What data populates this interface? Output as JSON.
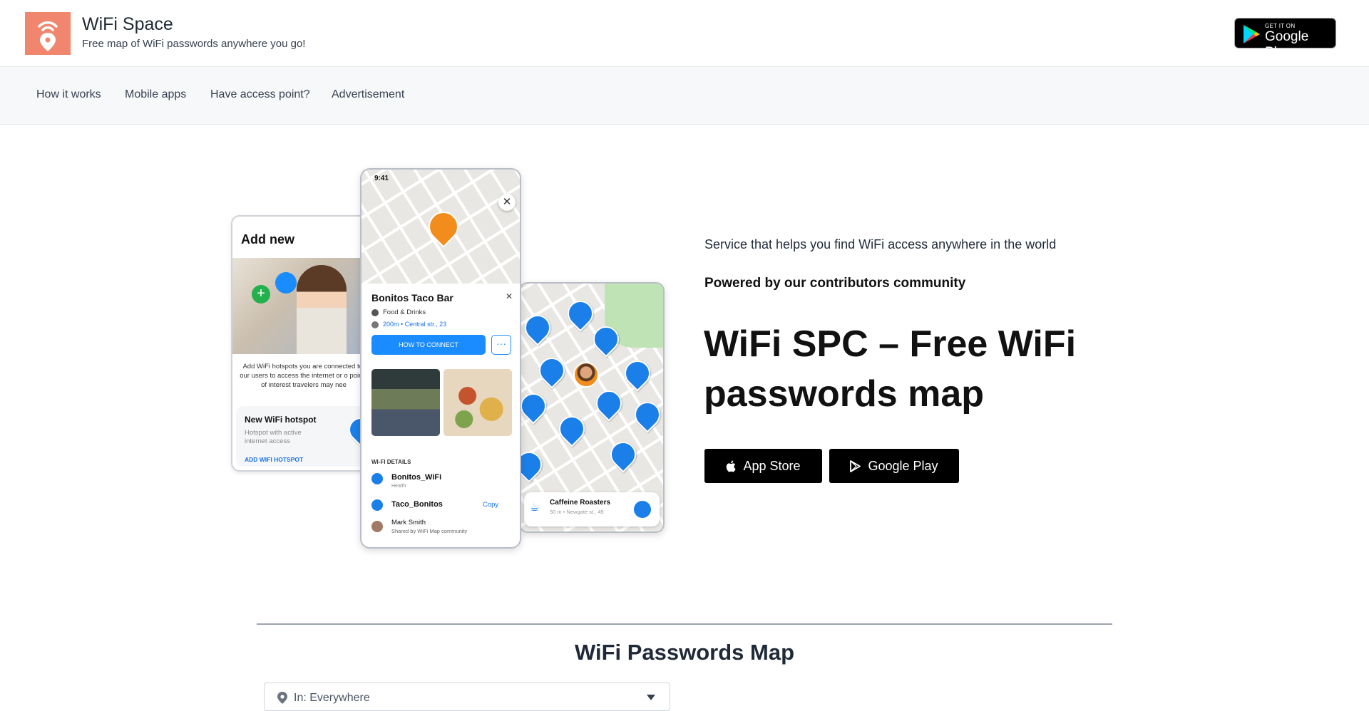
{
  "header": {
    "brand_title": "WiFi Space",
    "brand_tagline": "Free map of WiFi passwords anywhere you go!",
    "badge_small": "GET IT ON",
    "badge_big": "Google Play"
  },
  "nav": {
    "items": [
      {
        "label": "How it works"
      },
      {
        "label": "Mobile apps"
      },
      {
        "label": "Have access point?"
      },
      {
        "label": "Advertisement"
      }
    ]
  },
  "hero": {
    "subtitle": "Service that helps you find WiFi access anywhere in the world",
    "powered": "Powered by our contributors community",
    "title": "WiFi SPC – Free WiFi passwords map",
    "app_store_label": "App Store",
    "google_play_label": "Google Play"
  },
  "mockups": {
    "left": {
      "title": "Add new",
      "description": "Add WiFi hotspots you are connected to, our users to access the internet or o points of interest travelers may nee",
      "hotspot_title": "New WiFi hotspot",
      "hotspot_desc": "Hotspot with active internet access",
      "hotspot_link": "ADD WIFI HOTSPOT"
    },
    "middle": {
      "time": "9:41",
      "place_name": "Bonitos Taco Bar",
      "category": "Food & Drinks",
      "distance": "200m • Central str., 23",
      "connect_label": "HOW TO CONNECT",
      "more_label": "···",
      "wifi_details_label": "WI-FI DETAILS",
      "ssid": "Bonitos_WiFi",
      "health": "Health",
      "password": "Taco_Bonitos",
      "copy_label": "Copy",
      "contributor": "Mark Smith",
      "shared_by": "Shared by WiFi Map community"
    },
    "right": {
      "place_name": "Caffeine Roasters",
      "place_sub": "50 m • Newgate st., 49"
    }
  },
  "map_section": {
    "title": "WiFi Passwords Map",
    "location_value": "In: Everywhere"
  },
  "colors": {
    "brand": "#f0866d",
    "accent_blue": "#1a7fe8",
    "button_bg": "#000000"
  }
}
